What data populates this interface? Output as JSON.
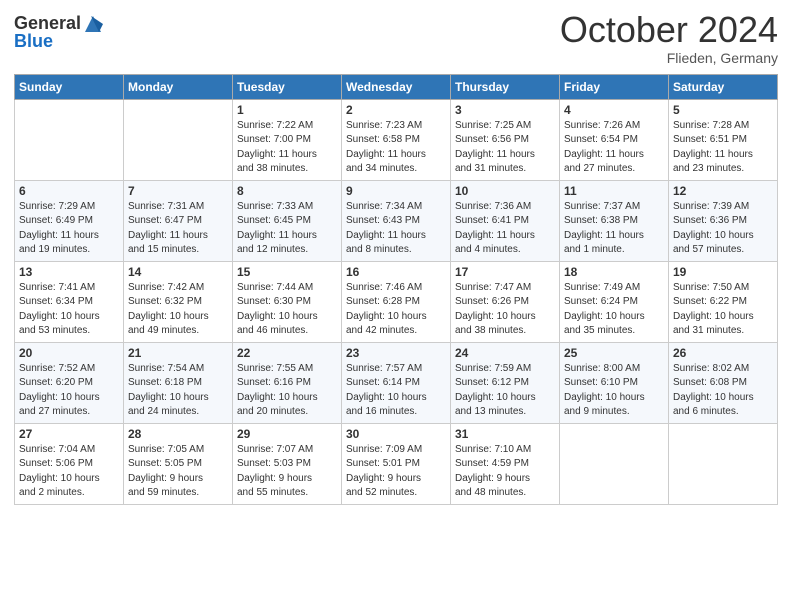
{
  "header": {
    "logo_general": "General",
    "logo_blue": "Blue",
    "month_title": "October 2024",
    "location": "Flieden, Germany"
  },
  "columns": [
    "Sunday",
    "Monday",
    "Tuesday",
    "Wednesday",
    "Thursday",
    "Friday",
    "Saturday"
  ],
  "weeks": [
    [
      {
        "day": "",
        "info": ""
      },
      {
        "day": "",
        "info": ""
      },
      {
        "day": "1",
        "info": "Sunrise: 7:22 AM\nSunset: 7:00 PM\nDaylight: 11 hours\nand 38 minutes."
      },
      {
        "day": "2",
        "info": "Sunrise: 7:23 AM\nSunset: 6:58 PM\nDaylight: 11 hours\nand 34 minutes."
      },
      {
        "day": "3",
        "info": "Sunrise: 7:25 AM\nSunset: 6:56 PM\nDaylight: 11 hours\nand 31 minutes."
      },
      {
        "day": "4",
        "info": "Sunrise: 7:26 AM\nSunset: 6:54 PM\nDaylight: 11 hours\nand 27 minutes."
      },
      {
        "day": "5",
        "info": "Sunrise: 7:28 AM\nSunset: 6:51 PM\nDaylight: 11 hours\nand 23 minutes."
      }
    ],
    [
      {
        "day": "6",
        "info": "Sunrise: 7:29 AM\nSunset: 6:49 PM\nDaylight: 11 hours\nand 19 minutes."
      },
      {
        "day": "7",
        "info": "Sunrise: 7:31 AM\nSunset: 6:47 PM\nDaylight: 11 hours\nand 15 minutes."
      },
      {
        "day": "8",
        "info": "Sunrise: 7:33 AM\nSunset: 6:45 PM\nDaylight: 11 hours\nand 12 minutes."
      },
      {
        "day": "9",
        "info": "Sunrise: 7:34 AM\nSunset: 6:43 PM\nDaylight: 11 hours\nand 8 minutes."
      },
      {
        "day": "10",
        "info": "Sunrise: 7:36 AM\nSunset: 6:41 PM\nDaylight: 11 hours\nand 4 minutes."
      },
      {
        "day": "11",
        "info": "Sunrise: 7:37 AM\nSunset: 6:38 PM\nDaylight: 11 hours\nand 1 minute."
      },
      {
        "day": "12",
        "info": "Sunrise: 7:39 AM\nSunset: 6:36 PM\nDaylight: 10 hours\nand 57 minutes."
      }
    ],
    [
      {
        "day": "13",
        "info": "Sunrise: 7:41 AM\nSunset: 6:34 PM\nDaylight: 10 hours\nand 53 minutes."
      },
      {
        "day": "14",
        "info": "Sunrise: 7:42 AM\nSunset: 6:32 PM\nDaylight: 10 hours\nand 49 minutes."
      },
      {
        "day": "15",
        "info": "Sunrise: 7:44 AM\nSunset: 6:30 PM\nDaylight: 10 hours\nand 46 minutes."
      },
      {
        "day": "16",
        "info": "Sunrise: 7:46 AM\nSunset: 6:28 PM\nDaylight: 10 hours\nand 42 minutes."
      },
      {
        "day": "17",
        "info": "Sunrise: 7:47 AM\nSunset: 6:26 PM\nDaylight: 10 hours\nand 38 minutes."
      },
      {
        "day": "18",
        "info": "Sunrise: 7:49 AM\nSunset: 6:24 PM\nDaylight: 10 hours\nand 35 minutes."
      },
      {
        "day": "19",
        "info": "Sunrise: 7:50 AM\nSunset: 6:22 PM\nDaylight: 10 hours\nand 31 minutes."
      }
    ],
    [
      {
        "day": "20",
        "info": "Sunrise: 7:52 AM\nSunset: 6:20 PM\nDaylight: 10 hours\nand 27 minutes."
      },
      {
        "day": "21",
        "info": "Sunrise: 7:54 AM\nSunset: 6:18 PM\nDaylight: 10 hours\nand 24 minutes."
      },
      {
        "day": "22",
        "info": "Sunrise: 7:55 AM\nSunset: 6:16 PM\nDaylight: 10 hours\nand 20 minutes."
      },
      {
        "day": "23",
        "info": "Sunrise: 7:57 AM\nSunset: 6:14 PM\nDaylight: 10 hours\nand 16 minutes."
      },
      {
        "day": "24",
        "info": "Sunrise: 7:59 AM\nSunset: 6:12 PM\nDaylight: 10 hours\nand 13 minutes."
      },
      {
        "day": "25",
        "info": "Sunrise: 8:00 AM\nSunset: 6:10 PM\nDaylight: 10 hours\nand 9 minutes."
      },
      {
        "day": "26",
        "info": "Sunrise: 8:02 AM\nSunset: 6:08 PM\nDaylight: 10 hours\nand 6 minutes."
      }
    ],
    [
      {
        "day": "27",
        "info": "Sunrise: 7:04 AM\nSunset: 5:06 PM\nDaylight: 10 hours\nand 2 minutes."
      },
      {
        "day": "28",
        "info": "Sunrise: 7:05 AM\nSunset: 5:05 PM\nDaylight: 9 hours\nand 59 minutes."
      },
      {
        "day": "29",
        "info": "Sunrise: 7:07 AM\nSunset: 5:03 PM\nDaylight: 9 hours\nand 55 minutes."
      },
      {
        "day": "30",
        "info": "Sunrise: 7:09 AM\nSunset: 5:01 PM\nDaylight: 9 hours\nand 52 minutes."
      },
      {
        "day": "31",
        "info": "Sunrise: 7:10 AM\nSunset: 4:59 PM\nDaylight: 9 hours\nand 48 minutes."
      },
      {
        "day": "",
        "info": ""
      },
      {
        "day": "",
        "info": ""
      }
    ]
  ]
}
